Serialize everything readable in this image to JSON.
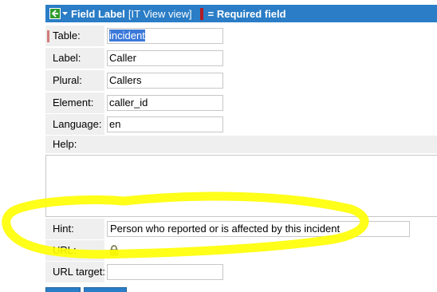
{
  "header": {
    "title": "Field Label",
    "view": "[IT View view]",
    "required_legend": "= Required field",
    "required_color": "#b01c24",
    "background": "#2a7dc6"
  },
  "form": {
    "table": {
      "label": "Table:",
      "value": "incident",
      "required": true
    },
    "label": {
      "label": "Label:",
      "value": "Caller"
    },
    "plural": {
      "label": "Plural:",
      "value": "Callers"
    },
    "element": {
      "label": "Element:",
      "value": "caller_id"
    },
    "language": {
      "label": "Language:",
      "value": "en"
    },
    "help": {
      "label": "Help:",
      "value": ""
    },
    "hint": {
      "label": "Hint:",
      "value": "Person who reported or is affected by this incident"
    },
    "url": {
      "label": "URL:",
      "icon": "lock-icon"
    },
    "url_target": {
      "label": "URL target:",
      "value": ""
    }
  },
  "buttons": {
    "submit_label": "",
    "update_label": ""
  },
  "icons": {
    "back": "back-arrow-icon",
    "menu": "context-menu-icon",
    "lock": "lock-icon"
  },
  "annotation": {
    "color": "#ffff00"
  }
}
